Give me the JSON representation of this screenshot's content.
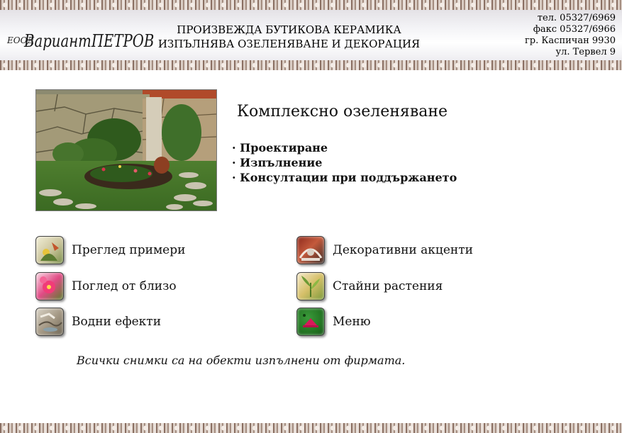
{
  "header": {
    "logo_prefix": "ЕООД",
    "logo_name": "ВариантПЕТРОВ",
    "slogan_line1": "ПРОИЗВЕЖДА БУТИКОВА КЕРАМИКА",
    "slogan_line2": "ИЗПЪЛНЯВА ОЗЕЛЕНЯВАНЕ И ДЕКОРАЦИЯ",
    "contacts": [
      "тел. 05327/6969",
      "факс 05327/6966",
      "гр. Каспичан 9930",
      "ул. Тервел 9"
    ]
  },
  "main": {
    "title": "Комплексно озеленяване",
    "services": [
      "· Проектиране",
      "· Изпълнение",
      "· Консултации при поддържането"
    ]
  },
  "nav": [
    {
      "label": "Преглед примери",
      "icon": "garden-thumb-icon"
    },
    {
      "label": "Поглед от близо",
      "icon": "flower-thumb-icon"
    },
    {
      "label": "Водни ефекти",
      "icon": "water-thumb-icon"
    },
    {
      "label": "Декоративни акценти",
      "icon": "decor-thumb-icon"
    },
    {
      "label": "Стайни растения",
      "icon": "plant-thumb-icon"
    },
    {
      "label": "Меню",
      "icon": "menu-home-icon"
    }
  ],
  "footnote": "Всички снимки са на обекти изпълнени от фирмата.",
  "colors": {
    "menu_green": "#1f6e1f",
    "menu_pink": "#d7195a",
    "border_brown": "#8a6f62"
  }
}
